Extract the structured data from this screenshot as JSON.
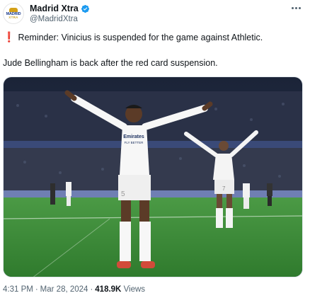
{
  "account": {
    "display_name": "Madrid Xtra",
    "handle": "@MadridXtra",
    "avatar_line1": "MADRID",
    "avatar_line2": "XTRA",
    "verified_icon": "verified-badge-icon",
    "verified_color": "#1d9bf0"
  },
  "tweet": {
    "alert_icon": "❗",
    "line1": "Reminder: Vinicius is suspended for the game against Athletic.",
    "line2": "Jude Bellingham is back after the red card suspension.",
    "media_icon": "stadium-celebration-photo"
  },
  "meta": {
    "time": "4:31 PM",
    "separator": "·",
    "date": "Mar 28, 2024",
    "views_count": "418.9K",
    "views_label": "Views"
  },
  "colors": {
    "text": "#0f1419",
    "muted": "#536471",
    "alert": "#e0245e",
    "pitch": "#3f8a3a"
  },
  "photo_text": {
    "shirt_sponsor_main": "Emirates",
    "shirt_sponsor_sub": "FLY BETTER",
    "number_main": "5",
    "number_second": "7"
  }
}
